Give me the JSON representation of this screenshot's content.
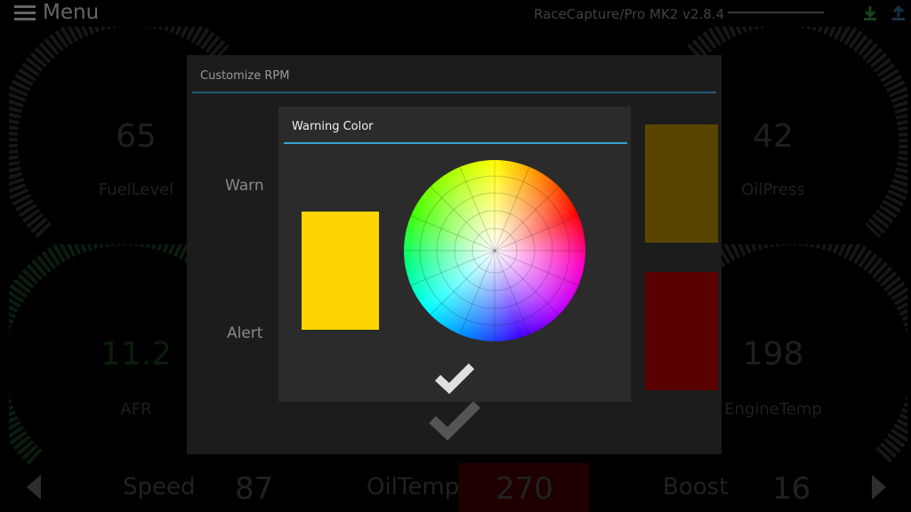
{
  "topbar": {
    "menu_label": "Menu",
    "device_title": "RaceCapture/Pro MK2 v2.8.4"
  },
  "gauges": {
    "fuel": {
      "value": "65",
      "label": "FuelLevel"
    },
    "oilpress": {
      "value": "42",
      "label": "OilPress"
    },
    "afr": {
      "value": "11.2",
      "label": "AFR"
    },
    "enginetemp": {
      "value": "198",
      "label": "EngineTemp"
    }
  },
  "bottom": {
    "speed_label": "Speed",
    "speed_value": "87",
    "oiltemp_label": "OilTemp",
    "oiltemp_value": "270",
    "boost_label": "Boost",
    "boost_value": "16"
  },
  "outer_dialog": {
    "title": "Customize RPM",
    "warn_label": "Warn",
    "alert_label": "Alert",
    "warn_color": "#5a4500",
    "alert_color": "#5a0000"
  },
  "inner_dialog": {
    "title": "Warning Color",
    "selected_color": "#ffd400",
    "accent_color": "#35a6d6"
  },
  "icons": [
    "menu-icon",
    "download-icon",
    "upload-icon",
    "checkmark-icon",
    "left-arrow-icon",
    "right-arrow-icon"
  ]
}
